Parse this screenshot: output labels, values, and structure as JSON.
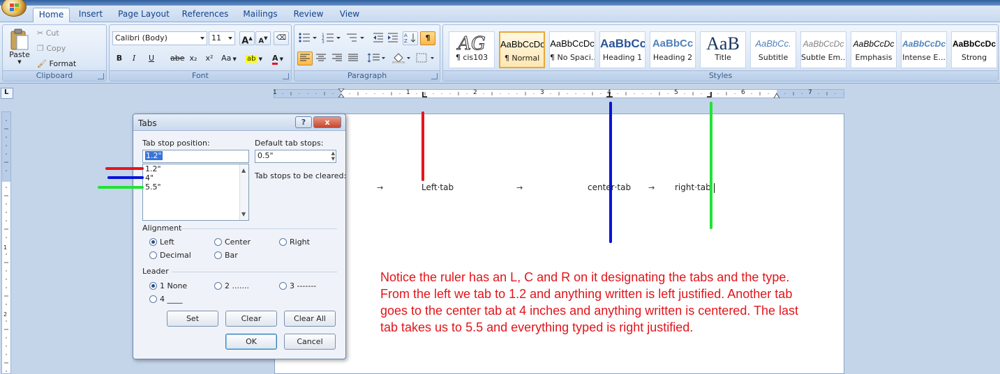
{
  "ribbon": {
    "tabs": [
      {
        "label": "Home",
        "active": true
      },
      {
        "label": "Insert"
      },
      {
        "label": "Page Layout"
      },
      {
        "label": "References"
      },
      {
        "label": "Mailings"
      },
      {
        "label": "Review"
      },
      {
        "label": "View"
      }
    ],
    "clipboard": {
      "group_label": "Clipboard",
      "paste": "Paste",
      "cut": "Cut",
      "copy": "Copy",
      "format_painter": "Format Painter"
    },
    "font": {
      "group_label": "Font",
      "font_name": "Calibri (Body)",
      "font_size": "11",
      "bold": "B",
      "italic": "I",
      "underline": "U",
      "strikethrough": "abe",
      "subscript": "x₂",
      "superscript": "x²",
      "change_case": "Aa",
      "grow": "A",
      "shrink": "A",
      "font_color": "A"
    },
    "paragraph": {
      "group_label": "Paragraph"
    },
    "styles": {
      "group_label": "Styles",
      "items": [
        {
          "preview": "AG",
          "name": "¶ cis103"
        },
        {
          "preview": "AaBbCcDc",
          "name": "¶ Normal",
          "selected": true
        },
        {
          "preview": "AaBbCcDc",
          "name": "¶ No Spaci..."
        },
        {
          "preview": "AaBbCc",
          "name": "Heading 1"
        },
        {
          "preview": "AaBbCc",
          "name": "Heading 2"
        },
        {
          "preview": "AaB",
          "name": "Title"
        },
        {
          "preview": "AaBbCc.",
          "name": "Subtitle"
        },
        {
          "preview": "AaBbCcDc",
          "name": "Subtle Em..."
        },
        {
          "preview": "AaBbCcDc",
          "name": "Emphasis"
        },
        {
          "preview": "AaBbCcDc",
          "name": "Intense E..."
        },
        {
          "preview": "AaBbCcDc",
          "name": "Strong"
        }
      ]
    }
  },
  "ruler": {
    "corner": "L",
    "numbers": [
      "1",
      "1",
      "2",
      "3",
      "4",
      "5",
      "6",
      "7"
    ]
  },
  "vertical_ruler": {
    "numbers": [
      "1",
      "2"
    ]
  },
  "dialog": {
    "title": "Tabs",
    "help": "?",
    "close": "x",
    "tab_stop_position_label": "Tab stop position:",
    "tab_stop_position_value": "1.2\"",
    "tab_stops": [
      "1.2\"",
      "4\"",
      "5.5\""
    ],
    "default_tab_stops_label": "Default tab stops:",
    "default_tab_stops_value": "0.5\"",
    "to_be_cleared_label": "Tab stops to be cleared:",
    "alignment_label": "Alignment",
    "alignment_options": [
      {
        "label": "Left",
        "checked": true
      },
      {
        "label": "Center"
      },
      {
        "label": "Right"
      },
      {
        "label": "Decimal"
      },
      {
        "label": "Bar"
      }
    ],
    "leader_label": "Leader",
    "leader_options": [
      {
        "label": "1 None",
        "checked": true
      },
      {
        "label": "2 ......."
      },
      {
        "label": "3 -------"
      },
      {
        "label": "4 ____"
      }
    ],
    "buttons": {
      "set": "Set",
      "clear": "Clear",
      "clear_all": "Clear All",
      "ok": "OK",
      "cancel": "Cancel"
    }
  },
  "document": {
    "left_tab_text": "Left·tab",
    "center_tab_text": "center·tab",
    "right_tab_text": "right·tab",
    "tab_arrow": "→",
    "note": "Notice the ruler has an L, C and R on it designating the tabs and the type. From the left we tab to 1.2 and anything written is left justified. Another tab goes to the center tab at 4 inches and anything written is centered. The last tab takes us to 5.5 and everything typed is right justified."
  },
  "colors": {
    "annotation_red": "#e8141b",
    "annotation_blue": "#0a14d8",
    "annotation_green": "#22e236",
    "note_text": "#e2141a"
  }
}
